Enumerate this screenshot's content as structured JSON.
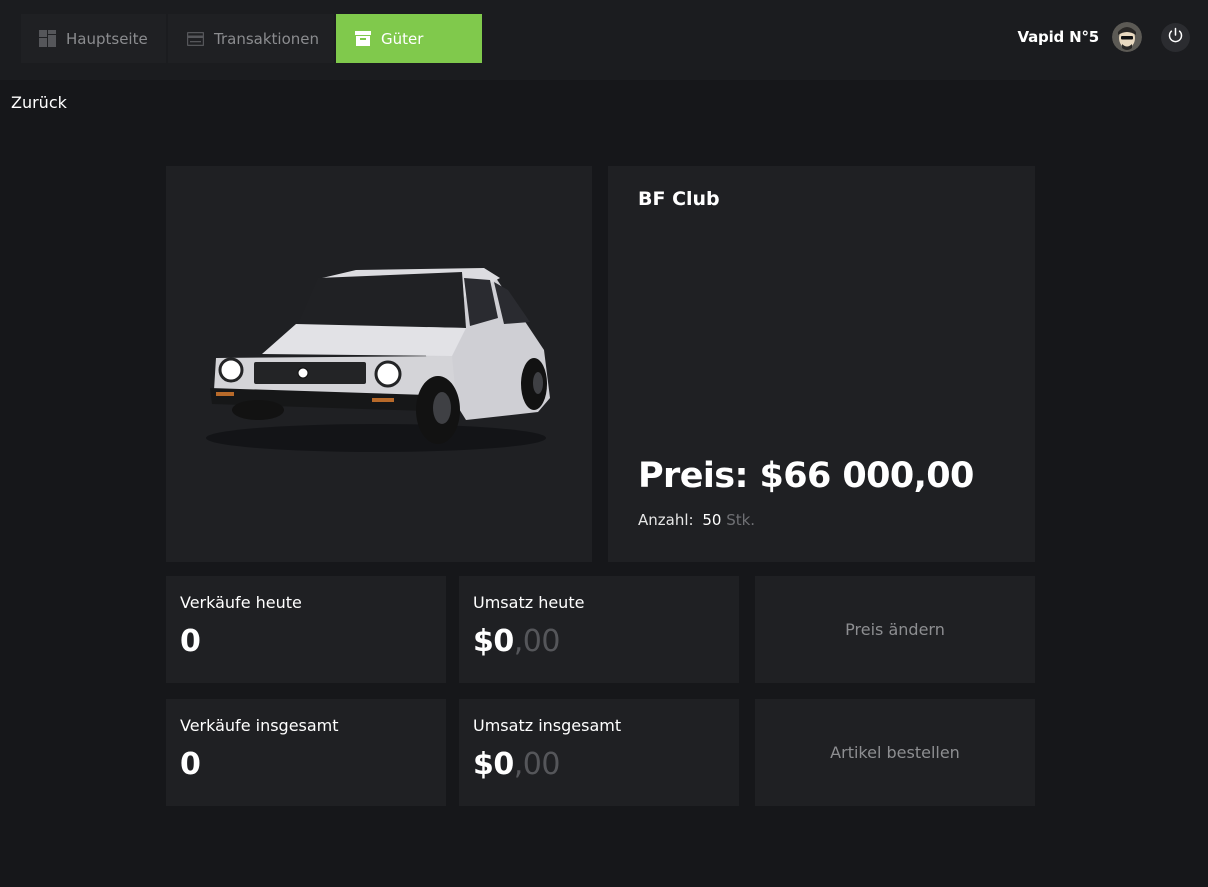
{
  "nav": {
    "tabs": [
      {
        "label": "Hauptseite",
        "icon": "dashboard-icon"
      },
      {
        "label": "Transaktionen",
        "icon": "card-icon"
      },
      {
        "label": "Güter",
        "icon": "box-icon",
        "active": true
      }
    ]
  },
  "user": {
    "name": "Vapid N°5"
  },
  "back": {
    "label": "Zurück"
  },
  "product": {
    "name": "BF Club",
    "price_label": "Preis:",
    "price_value": "$66 000,00",
    "quantity_label": "Anzahl:",
    "quantity_value": "50",
    "quantity_unit": "Stk."
  },
  "stats": {
    "sales_today": {
      "label": "Verkäufe heute",
      "value": "0"
    },
    "revenue_today": {
      "label": "Umsatz heute",
      "main": "$0",
      "decimals": ",00"
    },
    "sales_total": {
      "label": "Verkäufe insgesamt",
      "value": "0"
    },
    "revenue_total": {
      "label": "Umsatz insgesamt",
      "main": "$0",
      "decimals": ",00"
    }
  },
  "actions": {
    "change_price": "Preis ändern",
    "order_items": "Artikel bestellen"
  },
  "colors": {
    "accent": "#80c94c",
    "background": "#16171a",
    "card": "#1f2023"
  }
}
